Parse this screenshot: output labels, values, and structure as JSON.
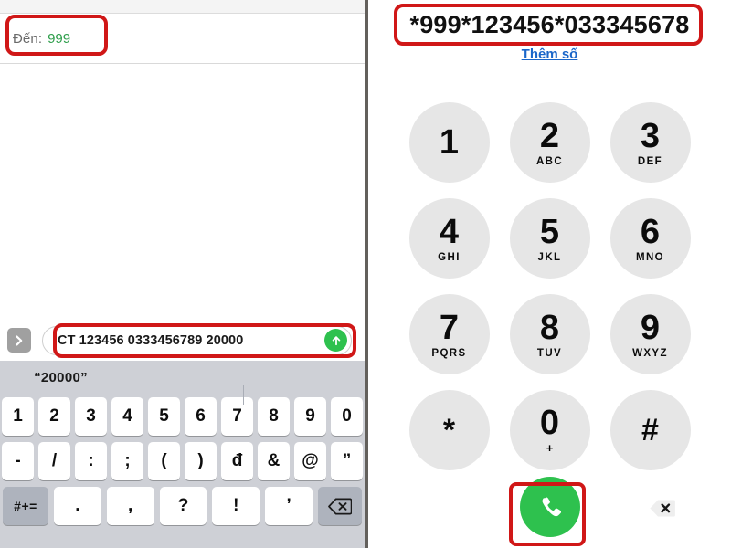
{
  "left_panel": {
    "recipient": {
      "label": "Đến:",
      "value": "999",
      "value_color": "#2e9e4b"
    },
    "compose": {
      "expand_icon": "chevron-right-icon",
      "message_text": "CT 123456 0333456789 20000",
      "send_icon": "arrow-up-icon"
    },
    "keyboard": {
      "suggestions": [
        "“20000”",
        "",
        ""
      ],
      "row1": [
        "1",
        "2",
        "3",
        "4",
        "5",
        "6",
        "7",
        "8",
        "9",
        "0"
      ],
      "row2": [
        "-",
        "/",
        ":",
        ";",
        "(",
        ")",
        "đ",
        "&",
        "@",
        "”"
      ],
      "row3_modifier": "#+=",
      "row3": [
        ".",
        ",",
        "?",
        "!",
        "’"
      ],
      "row3_backspace_icon": "backspace-icon"
    }
  },
  "right_panel": {
    "dialed_number": "*999*123456*033345678",
    "add_number_link": "Thêm số",
    "dialpad": [
      {
        "digit": "1",
        "letters": ""
      },
      {
        "digit": "2",
        "letters": "ABC"
      },
      {
        "digit": "3",
        "letters": "DEF"
      },
      {
        "digit": "4",
        "letters": "GHI"
      },
      {
        "digit": "5",
        "letters": "JKL"
      },
      {
        "digit": "6",
        "letters": "MNO"
      },
      {
        "digit": "7",
        "letters": "PQRS"
      },
      {
        "digit": "8",
        "letters": "TUV"
      },
      {
        "digit": "9",
        "letters": "WXYZ"
      },
      {
        "digit": "*",
        "letters": ""
      },
      {
        "digit": "0",
        "letters": "+"
      },
      {
        "digit": "#",
        "letters": ""
      }
    ],
    "call_button_icon": "phone-icon",
    "delete_button_icon": "backspace-icon"
  },
  "annotations": {
    "color": "#d01717",
    "boxes": [
      "recipient-field",
      "message-compose-field",
      "dialed-number-field",
      "call-button"
    ]
  }
}
